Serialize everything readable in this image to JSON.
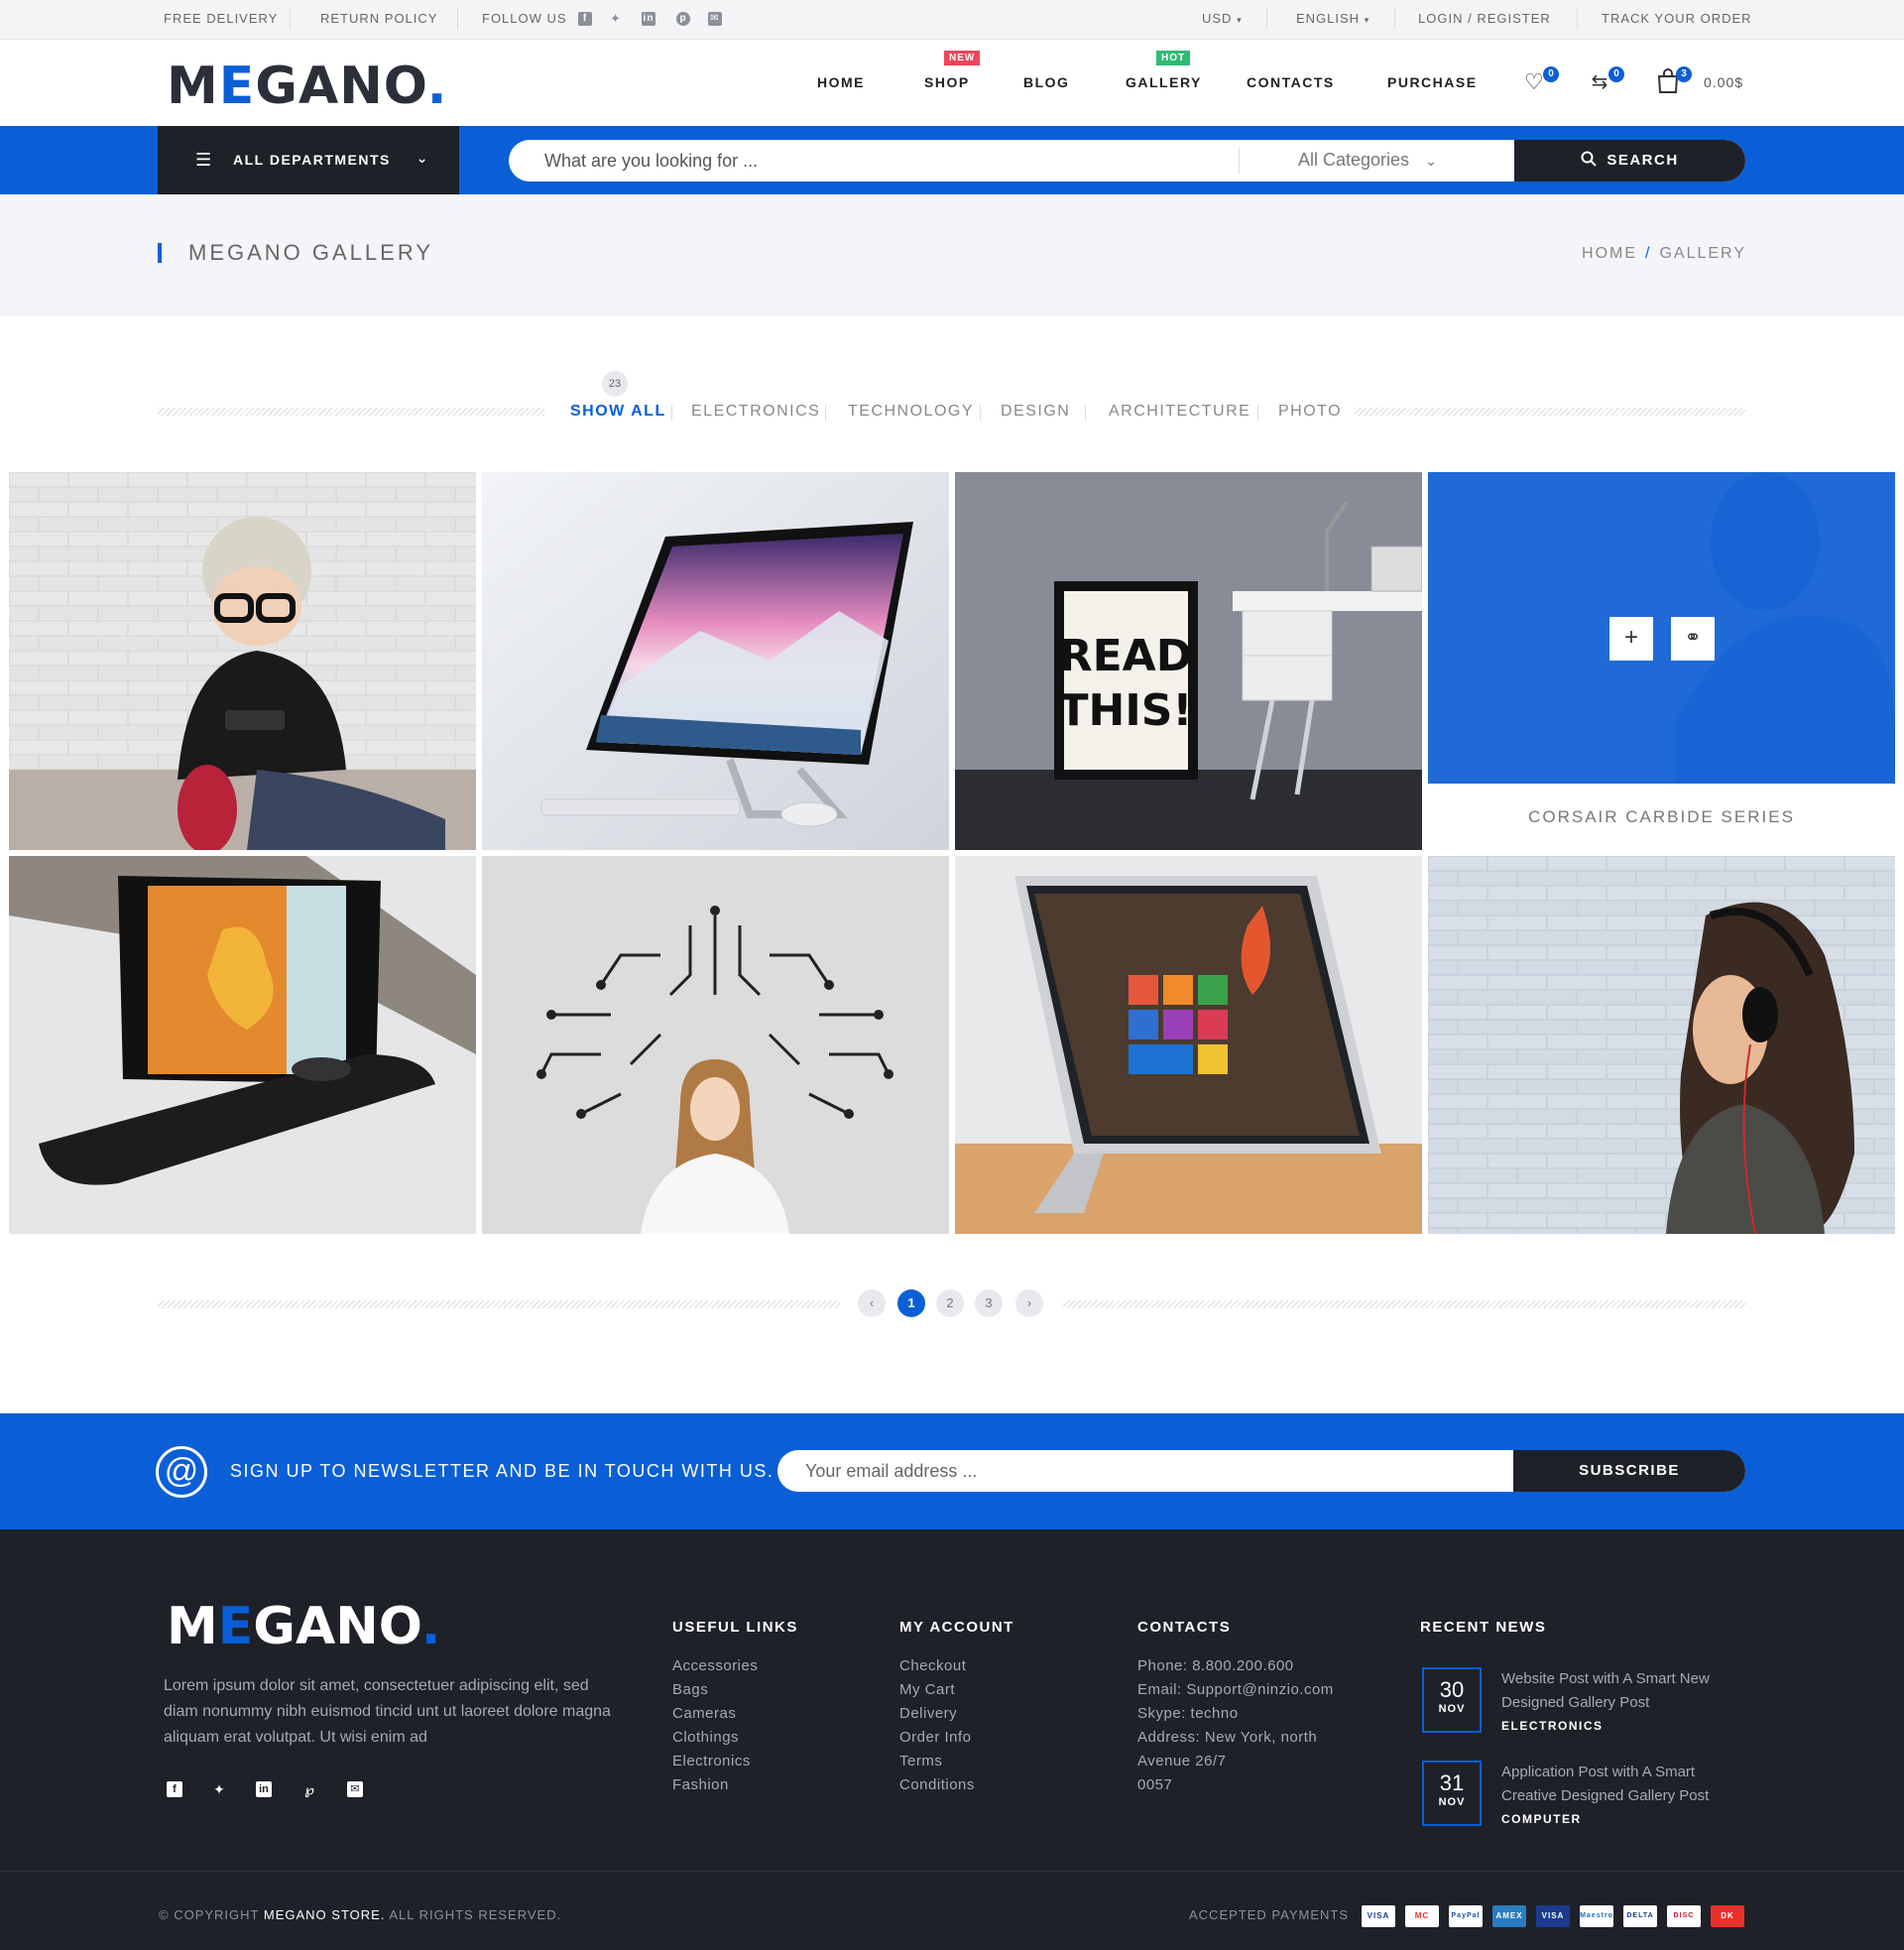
{
  "topbar": {
    "free_delivery": "FREE DELIVERY",
    "return_policy": "RETURN POLICY",
    "follow_us": "FOLLOW US",
    "social_icons": [
      "facebook-icon",
      "twitter-icon",
      "linkedin-icon",
      "pinterest-icon",
      "mail-icon"
    ],
    "currency": "USD",
    "language": "ENGLISH",
    "login": "LOGIN",
    "register": "REGISTER",
    "track_order": "TRACK YOUR ORDER"
  },
  "header": {
    "logo_m": "M",
    "logo_e": "E",
    "logo_rest": "GANO",
    "logo_dot": ".",
    "nav": {
      "home": "HOME",
      "shop": "SHOP",
      "shop_badge": "NEW",
      "blog": "BLOG",
      "gallery": "GALLERY",
      "gallery_badge": "HOT",
      "contacts": "CONTACTS",
      "purchase": "PURCHASE"
    },
    "wishlist_count": "0",
    "compare_count": "0",
    "cart_count": "3",
    "cart_total": "0.00$"
  },
  "searchbar": {
    "departments": "ALL DEPARTMENTS",
    "placeholder": "What are you looking for ...",
    "category": "All Categories",
    "button": "SEARCH"
  },
  "titleband": {
    "title": "MEGANO GALLERY",
    "crumb_home": "HOME",
    "crumb_sep": "/",
    "crumb_current": "GALLERY"
  },
  "filters": {
    "count": "23",
    "items": [
      "SHOW ALL",
      "ELECTRONICS",
      "TECHNOLOGY",
      "DESIGN",
      "ARCHITECTURE",
      "PHOTO"
    ]
  },
  "gallery": {
    "hover_caption": "CORSAIR CARBIDE SERIES"
  },
  "pagination": {
    "pages": [
      "1",
      "2",
      "3"
    ],
    "current": "1"
  },
  "newsletter": {
    "text": "SIGN UP TO NEWSLETTER AND BE IN TOUCH WITH US.",
    "placeholder": "Your email address ...",
    "button": "SUBSCRIBE"
  },
  "footer": {
    "about": "Lorem ipsum dolor sit amet, consectetuer adipiscing elit, sed diam nonummy nibh euismod tincid  unt ut laoreet dolore magna aliquam erat volutpat. Ut wisi enim ad",
    "useful_links": {
      "title": "USEFUL LINKS",
      "items": [
        "Accessories",
        "Bags",
        "Cameras",
        "Clothings",
        "Electronics",
        "Fashion"
      ]
    },
    "my_account": {
      "title": "MY ACCOUNT",
      "items": [
        "Checkout",
        "My Cart",
        "Delivery",
        "Order Info",
        "Terms",
        "Conditions"
      ]
    },
    "contacts": {
      "title": "CONTACTS",
      "items": [
        "Phone: 8.800.200.600",
        "Email: Support@ninzio.com",
        "Skype: techno",
        "Address: New York, north",
        "Avenue 26/7",
        "0057"
      ]
    },
    "recent_news": {
      "title": "RECENT NEWS",
      "items": [
        {
          "day": "30",
          "month": "NOV",
          "title": "Website Post with A Smart New Designed Gallery Post",
          "category": "ELECTRONICS"
        },
        {
          "day": "31",
          "month": "NOV",
          "title": "Application Post with A Smart Creative Designed Gallery Post",
          "category": "COMPUTER"
        }
      ]
    }
  },
  "bottom": {
    "copyright_prefix": "© COPYRIGHT",
    "store": "MEGANO STORE.",
    "rights": "ALL RIGHTS RESERVED.",
    "accepted": "ACCEPTED PAYMENTS",
    "payments": [
      "VISA",
      "MC",
      "PayPal",
      "AMEX",
      "VISA",
      "Maestro",
      "DELTA",
      "DISC",
      "DK"
    ]
  },
  "colors": {
    "accent": "#0a5fd7",
    "dark": "#1e2128",
    "new_badge": "#f0455b",
    "hot_badge": "#2dbb74"
  }
}
